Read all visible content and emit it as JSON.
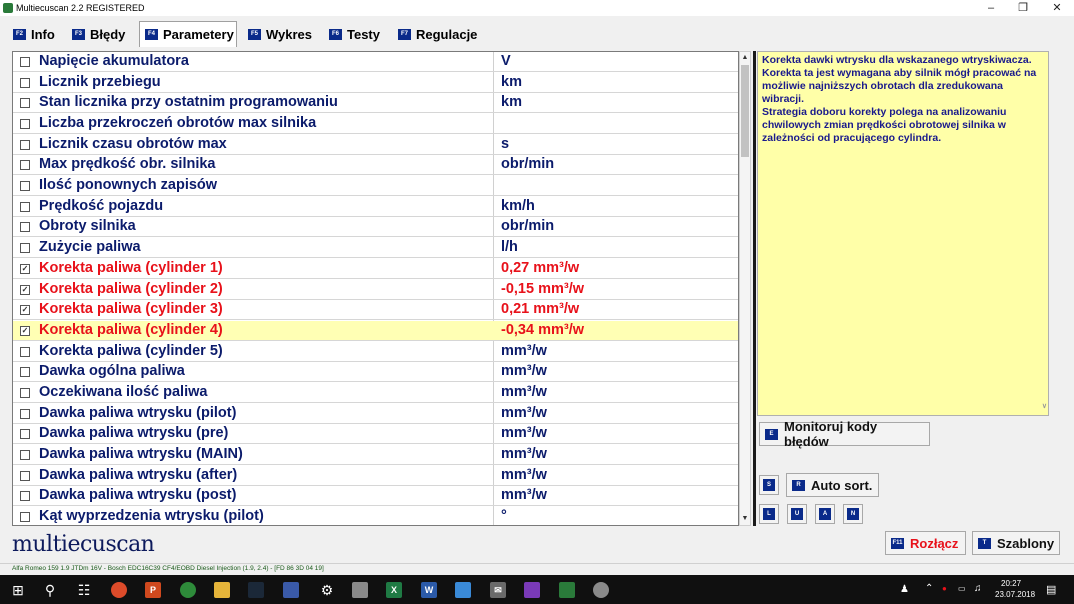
{
  "window": {
    "title": "Multiecuscan 2.2 REGISTERED"
  },
  "tabs": [
    {
      "key": "F2",
      "label": "Info"
    },
    {
      "key": "F3",
      "label": "Błędy"
    },
    {
      "key": "F4",
      "label": "Parametery"
    },
    {
      "key": "F5",
      "label": "Wykres"
    },
    {
      "key": "F6",
      "label": "Testy"
    },
    {
      "key": "F7",
      "label": "Regulacje"
    }
  ],
  "parameters": [
    {
      "name": "Napięcie akumulatora",
      "unit": "V",
      "checked": false
    },
    {
      "name": "Licznik przebiegu",
      "unit": "km",
      "checked": false
    },
    {
      "name": "Stan licznika przy ostatnim programowaniu",
      "unit": "km",
      "checked": false
    },
    {
      "name": "Liczba przekroczeń obrotów max silnika",
      "unit": "",
      "checked": false
    },
    {
      "name": "Licznik czasu obrotów max",
      "unit": "s",
      "checked": false
    },
    {
      "name": "Max prędkość obr. silnika",
      "unit": "obr/min",
      "checked": false
    },
    {
      "name": "Ilość ponownych zapisów",
      "unit": "",
      "checked": false
    },
    {
      "name": "Prędkość pojazdu",
      "unit": "km/h",
      "checked": false
    },
    {
      "name": "Obroty silnika",
      "unit": "obr/min",
      "checked": false
    },
    {
      "name": "Zużycie paliwa",
      "unit": "l/h",
      "checked": false
    },
    {
      "name": "Korekta paliwa (cylinder 1)",
      "unit": "0,27 mm³/w",
      "checked": true
    },
    {
      "name": "Korekta paliwa (cylinder 2)",
      "unit": "-0,15 mm³/w",
      "checked": true
    },
    {
      "name": "Korekta paliwa (cylinder 3)",
      "unit": "0,21 mm³/w",
      "checked": true
    },
    {
      "name": "Korekta paliwa (cylinder 4)",
      "unit": "-0,34 mm³/w",
      "checked": true,
      "selected": true
    },
    {
      "name": "Korekta paliwa (cylinder 5)",
      "unit": "mm³/w",
      "checked": false
    },
    {
      "name": "Dawka ogólna paliwa",
      "unit": "mm³/w",
      "checked": false
    },
    {
      "name": "Oczekiwana ilość paliwa",
      "unit": "mm³/w",
      "checked": false
    },
    {
      "name": "Dawka paliwa wtrysku (pilot)",
      "unit": "mm³/w",
      "checked": false
    },
    {
      "name": "Dawka paliwa wtrysku (pre)",
      "unit": "mm³/w",
      "checked": false
    },
    {
      "name": "Dawka paliwa wtrysku (MAIN)",
      "unit": "mm³/w",
      "checked": false
    },
    {
      "name": "Dawka paliwa wtrysku (after)",
      "unit": "mm³/w",
      "checked": false
    },
    {
      "name": "Dawka paliwa wtrysku (post)",
      "unit": "mm³/w",
      "checked": false
    },
    {
      "name": "Kąt wyprzedzenia wtrysku (pilot)",
      "unit": "°",
      "checked": false
    }
  ],
  "description": {
    "p1": "Korekta dawki wtrysku dla wskazanego wtryskiwacza. Korekta ta jest wymagana aby silnik mógł pracować na możliwie najniższych obrotach dla zredukowana wibracji.",
    "p2": "Strategia doboru korekty polega na analizowaniu chwilowych zmian prędkości obrotowej silnika w zależności od pracującego cylindra."
  },
  "buttons": {
    "monitor": {
      "key": "E",
      "label": "Monitoruj kody błędów"
    },
    "s": {
      "key": "S"
    },
    "autosort": {
      "key": "R",
      "label": "Auto sort."
    },
    "l": {
      "key": "L"
    },
    "u": {
      "key": "U"
    },
    "a": {
      "key": "A"
    },
    "n": {
      "key": "N"
    },
    "disconnect": {
      "key": "F11",
      "label": "Rozłącz"
    },
    "templates": {
      "key": "T",
      "label": "Szablony"
    }
  },
  "logo": "multiecuscan",
  "status": "Alfa Romeo 159 1.9 JTDm 16V - Bosch EDC16C39 CF4/EOBD Diesel Injection (1.9, 2.4) - [FD 86 3D 04 19]",
  "taskbar": {
    "time": "20:27",
    "date": "23.07.2018"
  },
  "colors": {
    "param_text": "#0b1b6b",
    "checked_text": "#e8111a",
    "selected_row": "#ffffb4",
    "description_bg": "#ffffa8",
    "key_badge": "#0a2a8a"
  }
}
